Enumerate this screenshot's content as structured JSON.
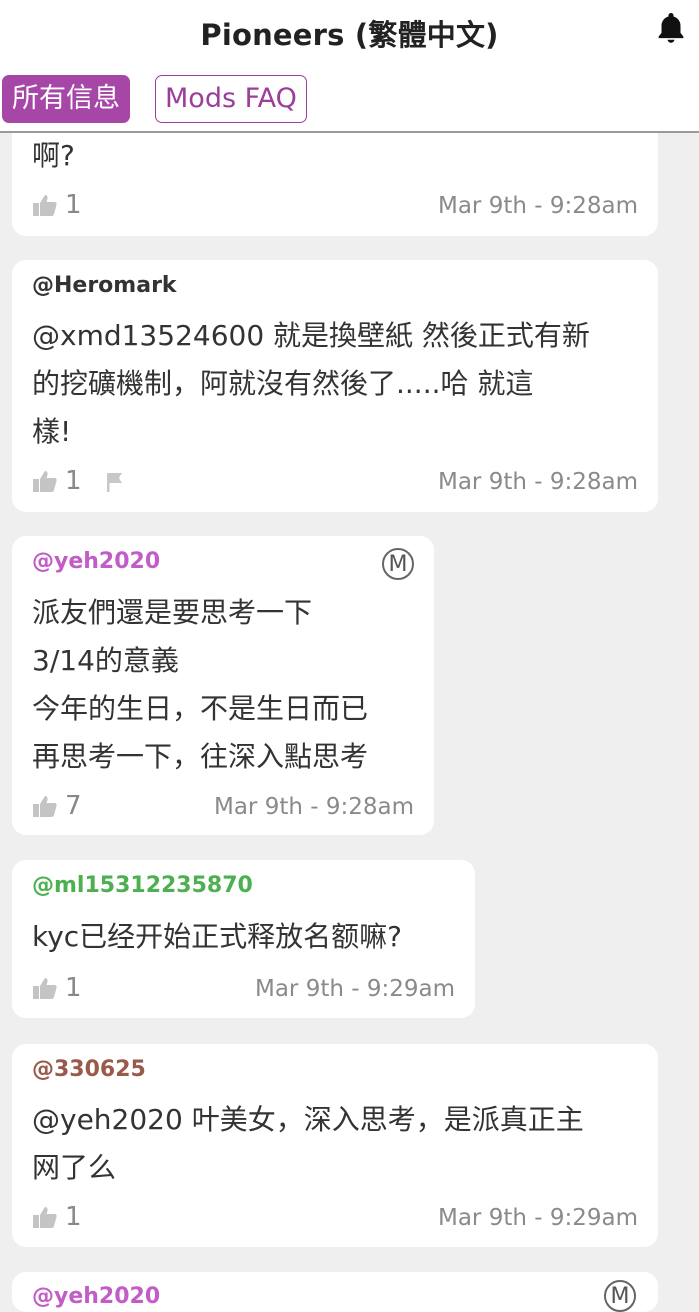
{
  "header": {
    "title": "Pioneers (繁體中文)",
    "tabs": [
      {
        "label": "所有信息"
      },
      {
        "label": "Mods FAQ"
      }
    ]
  },
  "icons": {
    "bell": "bell-icon",
    "like": "thumbs-up-icon",
    "flag": "flag-icon",
    "moderator": "moderator-badge-icon"
  },
  "colors": {
    "tab_active": "#a646a6",
    "author_default": "#333333",
    "author_moderator": "#c25cc7",
    "author_green": "#4caf50",
    "author_brown": "#9a5a4a"
  },
  "messages": [
    {
      "author": "",
      "lines": [
        "啊?"
      ],
      "likes": "1",
      "timestamp": "Mar 9th - 9:28am"
    },
    {
      "author": "@Heromark",
      "lines": [
        "@xmd13524600 就是換壁紙 然後正式有新",
        "的挖礦機制，阿就沒有然後了.....哈 就這",
        "樣!"
      ],
      "likes": "1",
      "timestamp": "Mar 9th - 9:28am"
    },
    {
      "author": "@yeh2020",
      "badge": "M",
      "lines": [
        "派友們還是要思考一下",
        "3/14的意義",
        "今年的生日，不是生日而已",
        "再思考一下，往深入點思考"
      ],
      "likes": "7",
      "timestamp": "Mar 9th - 9:28am"
    },
    {
      "author": "@ml15312235870",
      "lines": [
        "kyc已经开始正式释放名额嘛?"
      ],
      "likes": "1",
      "timestamp": "Mar 9th - 9:29am"
    },
    {
      "author": "@330625",
      "lines": [
        "@yeh2020 叶美女，深入思考，是派真正主",
        "网了么"
      ],
      "likes": "1",
      "timestamp": "Mar 9th - 9:29am"
    },
    {
      "author": "@yeh2020",
      "badge": "M"
    }
  ]
}
